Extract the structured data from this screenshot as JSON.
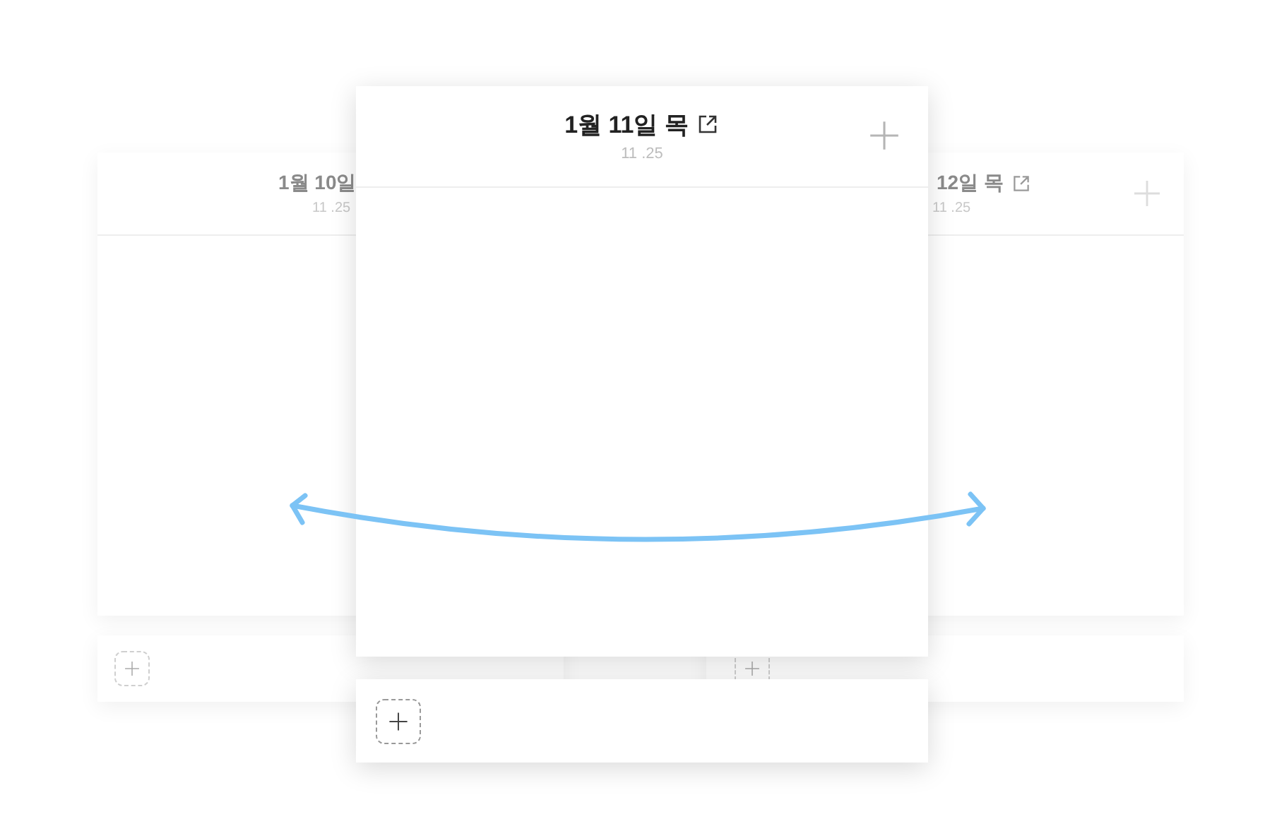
{
  "cards": [
    {
      "kind": "left",
      "title": "1월 10일",
      "date": "11 .25",
      "link_icon": false,
      "add_icon": false
    },
    {
      "kind": "right",
      "title": "12일 목",
      "date": "11 .25",
      "link_icon": true,
      "add_icon": true
    },
    {
      "kind": "center",
      "title": "1월 11일 목",
      "date": "11 .25",
      "link_icon": true,
      "add_icon": true
    }
  ]
}
